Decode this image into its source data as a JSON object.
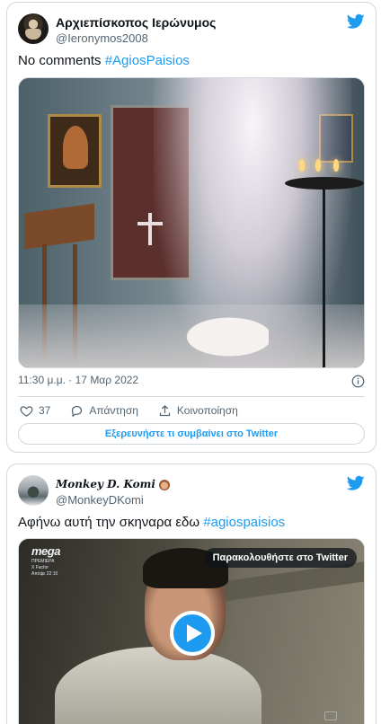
{
  "tweet1": {
    "author": {
      "display_name": "Αρχιεπίσκοπος Ιερώνυμος",
      "handle": "@Ieronymos2008"
    },
    "text": "No comments ",
    "hashtag": "#AgiosPaisios",
    "timestamp": "11:30 μ.μ. · 17 Μαρ 2022",
    "actions": {
      "like_count": "37",
      "reply_label": "Απάντηση",
      "share_label": "Κοινοποίηση"
    },
    "explore_label": "Εξερευνήστε τι συμβαίνει στο Twitter"
  },
  "tweet2": {
    "author": {
      "display_name": "Monkey D. Komi",
      "handle": "@MonkeyDKomi"
    },
    "text": "Αφήνω αυτή την σκηναρα εδω ",
    "hashtag": "#agiospaisios",
    "video": {
      "watch_label": "Παρακολουθήστε στο Twitter",
      "channel_logo": "mega",
      "channel_lines": [
        "ΠΡΕΜΙΕΡΑ",
        "X Factor",
        "Απόψε 22:10"
      ]
    }
  },
  "colors": {
    "accent": "#1d9bf0",
    "border": "#cfd9de",
    "muted": "#536471",
    "text": "#0f1419"
  },
  "icons": [
    "twitter-bird-icon",
    "info-icon",
    "heart-icon",
    "reply-icon",
    "share-icon",
    "play-icon"
  ]
}
